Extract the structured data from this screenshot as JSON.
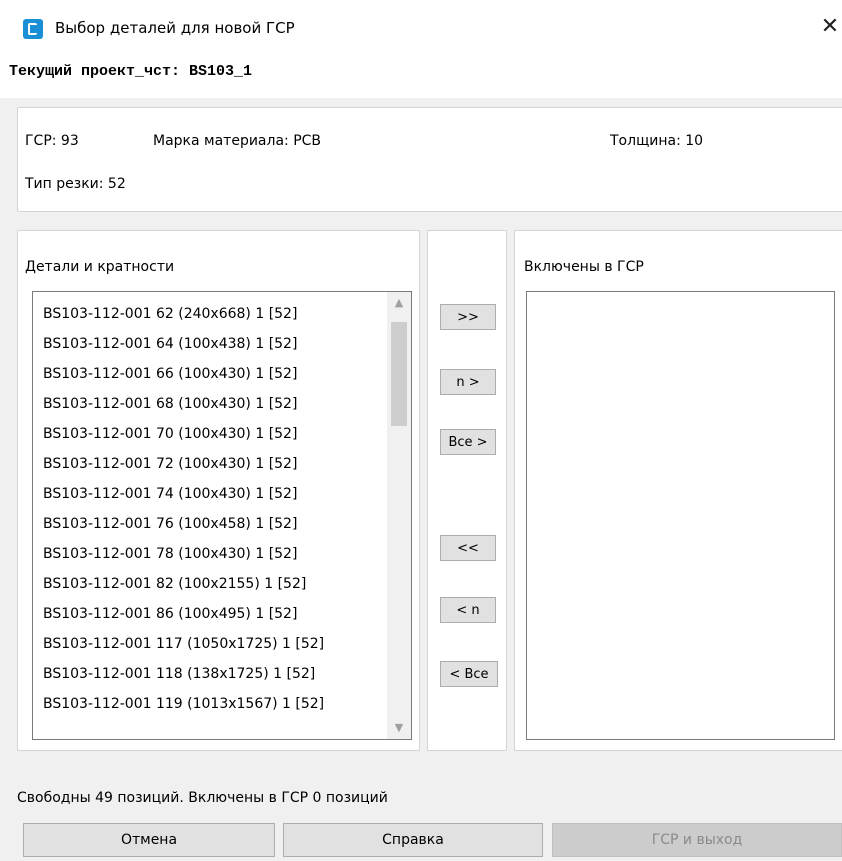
{
  "window": {
    "title": "Выбор деталей для новой ГСР",
    "close_glyph": "✕"
  },
  "project": {
    "label": "Текущий проект_чст: BS103_1"
  },
  "info": {
    "gsr": "ГСР: 93",
    "material": "Марка материала: PCB",
    "thickness": "Толщина: 10",
    "cut_type": "Тип резки: 52"
  },
  "details": {
    "title": "Детали и кратности",
    "items": [
      "BS103-112-001 62 (240x668) 1 [52]",
      "BS103-112-001 64 (100x438) 1 [52]",
      "BS103-112-001 66 (100x430) 1 [52]",
      "BS103-112-001 68 (100x430) 1 [52]",
      "BS103-112-001 70 (100x430) 1 [52]",
      "BS103-112-001 72 (100x430) 1 [52]",
      "BS103-112-001 74 (100x430) 1 [52]",
      "BS103-112-001 76 (100x458) 1 [52]",
      "BS103-112-001 78 (100x430) 1 [52]",
      "BS103-112-001 82 (100x2155) 1 [52]",
      "BS103-112-001 86 (100x495) 1 [52]",
      "BS103-112-001 117 (1050x1725) 1 [52]",
      "BS103-112-001 118 (138x1725) 1 [52]",
      "BS103-112-001 119 (1013x1567) 1 [52]"
    ]
  },
  "included": {
    "title": "Включены в ГСР",
    "items": []
  },
  "transfer": {
    "move_right": ">>",
    "move_n_right": "n >",
    "move_all_right": "Все >",
    "move_left": "<<",
    "move_n_left": "< n",
    "move_all_left": "< Все"
  },
  "status": "Свободны 49 позиций. Включены в ГСР 0 позиций",
  "footer": {
    "cancel": "Отмена",
    "help": "Справка",
    "gsr_exit": "ГСР и выход"
  },
  "icons": {
    "app": "app-logo-icon",
    "scroll_up": "▲",
    "scroll_down": "▼"
  }
}
